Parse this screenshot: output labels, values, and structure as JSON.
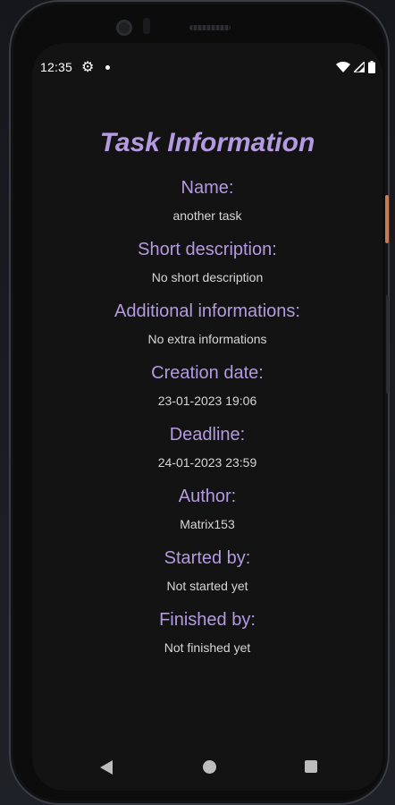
{
  "status_bar": {
    "time": "12:35",
    "icons": [
      "gear-icon",
      "notification-dot-icon",
      "wifi-icon",
      "signal-icon",
      "battery-icon"
    ]
  },
  "page": {
    "title": "Task Information"
  },
  "fields": [
    {
      "label": "Name:",
      "value": "another task"
    },
    {
      "label": "Short description:",
      "value": "No short description"
    },
    {
      "label": "Additional informations:",
      "value": "No extra informations"
    },
    {
      "label": "Creation date:",
      "value": "23-01-2023 19:06"
    },
    {
      "label": "Deadline:",
      "value": "24-01-2023 23:59"
    },
    {
      "label": "Author:",
      "value": "Matrix153"
    },
    {
      "label": "Started by:",
      "value": "Not started yet"
    },
    {
      "label": "Finished by:",
      "value": "Not finished yet"
    }
  ],
  "navigation_bar": {
    "icons": [
      "back-icon",
      "home-icon",
      "recent-apps-icon"
    ]
  },
  "colors": {
    "accent": "#b49ae0",
    "background": "#131314",
    "value_text": "#d6d6d6"
  }
}
